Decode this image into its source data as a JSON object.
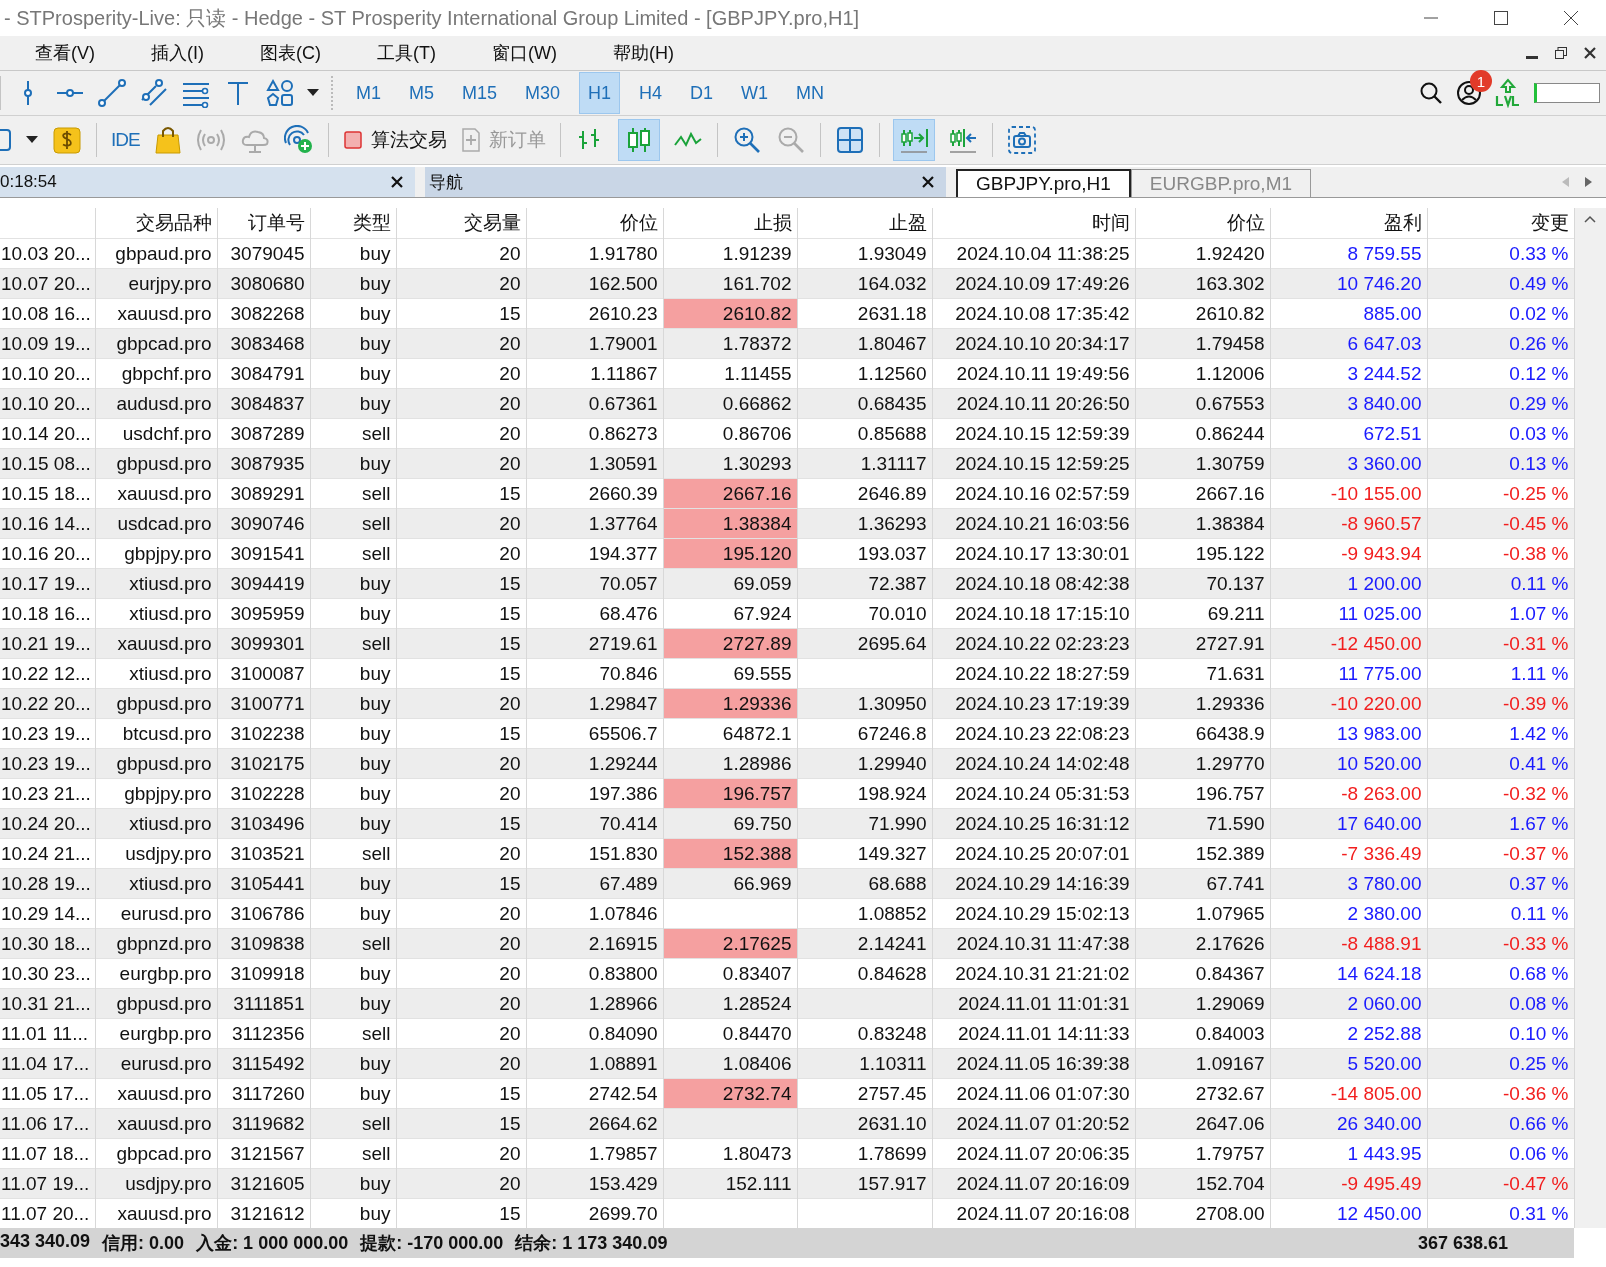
{
  "window": {
    "title": "- STProsperity-Live: 只读 - Hedge - ST Prosperity International Group Limited - [GBPJPY.pro,H1]"
  },
  "menu": [
    "查看(V)",
    "插入(I)",
    "图表(C)",
    "工具(T)",
    "窗口(W)",
    "帮助(H)"
  ],
  "timeframes": [
    {
      "label": "M1",
      "selected": false
    },
    {
      "label": "M5",
      "selected": false
    },
    {
      "label": "M15",
      "selected": false
    },
    {
      "label": "M30",
      "selected": false
    },
    {
      "label": "H1",
      "selected": true
    },
    {
      "label": "H4",
      "selected": false
    },
    {
      "label": "D1",
      "selected": false
    },
    {
      "label": "W1",
      "selected": false
    },
    {
      "label": "MN",
      "selected": false
    }
  ],
  "notifications": {
    "badge": "1"
  },
  "toolbar_2": {
    "ide": "IDE",
    "algo_trading": {
      "label": "算法交易",
      "on": false
    },
    "new_order": {
      "label": "新订单",
      "disabled": true
    },
    "chart_types": [
      {
        "selected": false
      },
      {
        "selected": true
      },
      {
        "selected": false
      }
    ],
    "scroll_tools": [
      {
        "selected": true
      },
      {
        "selected": false
      }
    ]
  },
  "panels": [
    {
      "title": "0:18:54"
    },
    {
      "title": "导航"
    }
  ],
  "chart_tabs": [
    {
      "label": "GBPJPY.pro,H1",
      "selected": true
    },
    {
      "label": "EURGBP.pro,M1",
      "selected": false
    }
  ],
  "table": {
    "columns": [
      "",
      "交易品种",
      "订单号",
      "类型",
      "交易量",
      "价位",
      "止损",
      "止盈",
      "时间",
      "价位",
      "盈利",
      "变更"
    ],
    "rows": [
      {
        "open": "10.03 20...",
        "symbol": "gbpaud.pro",
        "order": "3079045",
        "type": "buy",
        "volume": "20",
        "price": "1.91780",
        "sl": "1.91239",
        "tp": "1.93049",
        "time": "2024.10.04 11:38:25",
        "close": "1.92420",
        "profit": "8 759.55",
        "change": "0.33 %",
        "sl_hit": false,
        "loss": false
      },
      {
        "open": "10.07 20...",
        "symbol": "eurjpy.pro",
        "order": "3080680",
        "type": "buy",
        "volume": "20",
        "price": "162.500",
        "sl": "161.702",
        "tp": "164.032",
        "time": "2024.10.09 17:49:26",
        "close": "163.302",
        "profit": "10 746.20",
        "change": "0.49 %",
        "sl_hit": false,
        "loss": false
      },
      {
        "open": "10.08 16...",
        "symbol": "xauusd.pro",
        "order": "3082268",
        "type": "buy",
        "volume": "15",
        "price": "2610.23",
        "sl": "2610.82",
        "tp": "2631.18",
        "time": "2024.10.08 17:35:42",
        "close": "2610.82",
        "profit": "885.00",
        "change": "0.02 %",
        "sl_hit": true,
        "loss": false
      },
      {
        "open": "10.09 19...",
        "symbol": "gbpcad.pro",
        "order": "3083468",
        "type": "buy",
        "volume": "20",
        "price": "1.79001",
        "sl": "1.78372",
        "tp": "1.80467",
        "time": "2024.10.10 20:34:17",
        "close": "1.79458",
        "profit": "6 647.03",
        "change": "0.26 %",
        "sl_hit": false,
        "loss": false
      },
      {
        "open": "10.10 20...",
        "symbol": "gbpchf.pro",
        "order": "3084791",
        "type": "buy",
        "volume": "20",
        "price": "1.11867",
        "sl": "1.11455",
        "tp": "1.12560",
        "time": "2024.10.11 19:49:56",
        "close": "1.12006",
        "profit": "3 244.52",
        "change": "0.12 %",
        "sl_hit": false,
        "loss": false
      },
      {
        "open": "10.10 20...",
        "symbol": "audusd.pro",
        "order": "3084837",
        "type": "buy",
        "volume": "20",
        "price": "0.67361",
        "sl": "0.66862",
        "tp": "0.68435",
        "time": "2024.10.11 20:26:50",
        "close": "0.67553",
        "profit": "3 840.00",
        "change": "0.29 %",
        "sl_hit": false,
        "loss": false
      },
      {
        "open": "10.14 20...",
        "symbol": "usdchf.pro",
        "order": "3087289",
        "type": "sell",
        "volume": "20",
        "price": "0.86273",
        "sl": "0.86706",
        "tp": "0.85688",
        "time": "2024.10.15 12:59:39",
        "close": "0.86244",
        "profit": "672.51",
        "change": "0.03 %",
        "sl_hit": false,
        "loss": false
      },
      {
        "open": "10.15 08...",
        "symbol": "gbpusd.pro",
        "order": "3087935",
        "type": "buy",
        "volume": "20",
        "price": "1.30591",
        "sl": "1.30293",
        "tp": "1.31117",
        "time": "2024.10.15 12:59:25",
        "close": "1.30759",
        "profit": "3 360.00",
        "change": "0.13 %",
        "sl_hit": false,
        "loss": false
      },
      {
        "open": "10.15 18...",
        "symbol": "xauusd.pro",
        "order": "3089291",
        "type": "sell",
        "volume": "15",
        "price": "2660.39",
        "sl": "2667.16",
        "tp": "2646.89",
        "time": "2024.10.16 02:57:59",
        "close": "2667.16",
        "profit": "-10 155.00",
        "change": "-0.25 %",
        "sl_hit": true,
        "loss": true
      },
      {
        "open": "10.16 14...",
        "symbol": "usdcad.pro",
        "order": "3090746",
        "type": "sell",
        "volume": "20",
        "price": "1.37764",
        "sl": "1.38384",
        "tp": "1.36293",
        "time": "2024.10.21 16:03:56",
        "close": "1.38384",
        "profit": "-8 960.57",
        "change": "-0.45 %",
        "sl_hit": true,
        "loss": true
      },
      {
        "open": "10.16 20...",
        "symbol": "gbpjpy.pro",
        "order": "3091541",
        "type": "sell",
        "volume": "20",
        "price": "194.377",
        "sl": "195.120",
        "tp": "193.037",
        "time": "2024.10.17 13:30:01",
        "close": "195.122",
        "profit": "-9 943.94",
        "change": "-0.38 %",
        "sl_hit": true,
        "loss": true
      },
      {
        "open": "10.17 19...",
        "symbol": "xtiusd.pro",
        "order": "3094419",
        "type": "buy",
        "volume": "15",
        "price": "70.057",
        "sl": "69.059",
        "tp": "72.387",
        "time": "2024.10.18 08:42:38",
        "close": "70.137",
        "profit": "1 200.00",
        "change": "0.11 %",
        "sl_hit": false,
        "loss": false
      },
      {
        "open": "10.18 16...",
        "symbol": "xtiusd.pro",
        "order": "3095959",
        "type": "buy",
        "volume": "15",
        "price": "68.476",
        "sl": "67.924",
        "tp": "70.010",
        "time": "2024.10.18 17:15:10",
        "close": "69.211",
        "profit": "11 025.00",
        "change": "1.07 %",
        "sl_hit": false,
        "loss": false
      },
      {
        "open": "10.21 19...",
        "symbol": "xauusd.pro",
        "order": "3099301",
        "type": "sell",
        "volume": "15",
        "price": "2719.61",
        "sl": "2727.89",
        "tp": "2695.64",
        "time": "2024.10.22 02:23:23",
        "close": "2727.91",
        "profit": "-12 450.00",
        "change": "-0.31 %",
        "sl_hit": true,
        "loss": true
      },
      {
        "open": "10.22 12...",
        "symbol": "xtiusd.pro",
        "order": "3100087",
        "type": "buy",
        "volume": "15",
        "price": "70.846",
        "sl": "69.555",
        "time": "2024.10.22 18:27:59",
        "close": "71.631",
        "profit": "11 775.00",
        "change": "1.11 %",
        "sl_hit": false,
        "loss": false
      },
      {
        "open": "10.22 20...",
        "symbol": "gbpusd.pro",
        "order": "3100771",
        "type": "buy",
        "volume": "20",
        "price": "1.29847",
        "sl": "1.29336",
        "tp": "1.30950",
        "time": "2024.10.23 17:19:39",
        "close": "1.29336",
        "profit": "-10 220.00",
        "change": "-0.39 %",
        "sl_hit": true,
        "loss": true
      },
      {
        "open": "10.23 19...",
        "symbol": "btcusd.pro",
        "order": "3102238",
        "type": "buy",
        "volume": "15",
        "price": "65506.7",
        "sl": "64872.1",
        "tp": "67246.8",
        "time": "2024.10.23 22:08:23",
        "close": "66438.9",
        "profit": "13 983.00",
        "change": "1.42 %",
        "sl_hit": false,
        "loss": false
      },
      {
        "open": "10.23 19...",
        "symbol": "gbpusd.pro",
        "order": "3102175",
        "type": "buy",
        "volume": "20",
        "price": "1.29244",
        "sl": "1.28986",
        "tp": "1.29940",
        "time": "2024.10.24 14:02:48",
        "close": "1.29770",
        "profit": "10 520.00",
        "change": "0.41 %",
        "sl_hit": false,
        "loss": false
      },
      {
        "open": "10.23 21...",
        "symbol": "gbpjpy.pro",
        "order": "3102228",
        "type": "buy",
        "volume": "20",
        "price": "197.386",
        "sl": "196.757",
        "tp": "198.924",
        "time": "2024.10.24 05:31:53",
        "close": "196.757",
        "profit": "-8 263.00",
        "change": "-0.32 %",
        "sl_hit": true,
        "loss": true
      },
      {
        "open": "10.24 20...",
        "symbol": "xtiusd.pro",
        "order": "3103496",
        "type": "buy",
        "volume": "15",
        "price": "70.414",
        "sl": "69.750",
        "tp": "71.990",
        "time": "2024.10.25 16:31:12",
        "close": "71.590",
        "profit": "17 640.00",
        "change": "1.67 %",
        "sl_hit": false,
        "loss": false
      },
      {
        "open": "10.24 21...",
        "symbol": "usdjpy.pro",
        "order": "3103521",
        "type": "sell",
        "volume": "20",
        "price": "151.830",
        "sl": "152.388",
        "tp": "149.327",
        "time": "2024.10.25 20:07:01",
        "close": "152.389",
        "profit": "-7 336.49",
        "change": "-0.37 %",
        "sl_hit": true,
        "loss": true
      },
      {
        "open": "10.28 19...",
        "symbol": "xtiusd.pro",
        "order": "3105441",
        "type": "buy",
        "volume": "15",
        "price": "67.489",
        "sl": "66.969",
        "tp": "68.688",
        "time": "2024.10.29 14:16:39",
        "close": "67.741",
        "profit": "3 780.00",
        "change": "0.37 %",
        "sl_hit": false,
        "loss": false
      },
      {
        "open": "10.29 14...",
        "symbol": "eurusd.pro",
        "order": "3106786",
        "type": "buy",
        "volume": "20",
        "price": "1.07846",
        "tp": "1.08852",
        "time": "2024.10.29 15:02:13",
        "close": "1.07965",
        "profit": "2 380.00",
        "change": "0.11 %",
        "sl_hit": false,
        "loss": false
      },
      {
        "open": "10.30 18...",
        "symbol": "gbpnzd.pro",
        "order": "3109838",
        "type": "sell",
        "volume": "20",
        "price": "2.16915",
        "sl": "2.17625",
        "tp": "2.14241",
        "time": "2024.10.31 11:47:38",
        "close": "2.17626",
        "profit": "-8 488.91",
        "change": "-0.33 %",
        "sl_hit": true,
        "loss": true
      },
      {
        "open": "10.30 23...",
        "symbol": "eurgbp.pro",
        "order": "3109918",
        "type": "buy",
        "volume": "20",
        "price": "0.83800",
        "sl": "0.83407",
        "tp": "0.84628",
        "time": "2024.10.31 21:21:02",
        "close": "0.84367",
        "profit": "14 624.18",
        "change": "0.68 %",
        "sl_hit": false,
        "loss": false
      },
      {
        "open": "10.31 21...",
        "symbol": "gbpusd.pro",
        "order": "3111851",
        "type": "buy",
        "volume": "20",
        "price": "1.28966",
        "sl": "1.28524",
        "time": "2024.11.01 11:01:31",
        "close": "1.29069",
        "profit": "2 060.00",
        "change": "0.08 %",
        "sl_hit": false,
        "loss": false
      },
      {
        "open": "11.01 11...",
        "symbol": "eurgbp.pro",
        "order": "3112356",
        "type": "sell",
        "volume": "20",
        "price": "0.84090",
        "sl": "0.84470",
        "tp": "0.83248",
        "time": "2024.11.01 14:11:33",
        "close": "0.84003",
        "profit": "2 252.88",
        "change": "0.10 %",
        "sl_hit": false,
        "loss": false
      },
      {
        "open": "11.04 17...",
        "symbol": "eurusd.pro",
        "order": "3115492",
        "type": "buy",
        "volume": "20",
        "price": "1.08891",
        "sl": "1.08406",
        "tp": "1.10311",
        "time": "2024.11.05 16:39:38",
        "close": "1.09167",
        "profit": "5 520.00",
        "change": "0.25 %",
        "sl_hit": false,
        "loss": false
      },
      {
        "open": "11.05 17...",
        "symbol": "xauusd.pro",
        "order": "3117260",
        "type": "buy",
        "volume": "15",
        "price": "2742.54",
        "sl": "2732.74",
        "tp": "2757.45",
        "time": "2024.11.06 01:07:30",
        "close": "2732.67",
        "profit": "-14 805.00",
        "change": "-0.36 %",
        "sl_hit": true,
        "loss": true
      },
      {
        "open": "11.06 17...",
        "symbol": "xauusd.pro",
        "order": "3119682",
        "type": "sell",
        "volume": "15",
        "price": "2664.62",
        "tp": "2631.10",
        "time": "2024.11.07 01:20:52",
        "close": "2647.06",
        "profit": "26 340.00",
        "change": "0.66 %",
        "sl_hit": false,
        "loss": false
      },
      {
        "open": "11.07 18...",
        "symbol": "gbpcad.pro",
        "order": "3121567",
        "type": "sell",
        "volume": "20",
        "price": "1.79857",
        "sl": "1.80473",
        "tp": "1.78699",
        "time": "2024.11.07 20:06:35",
        "close": "1.79757",
        "profit": "1 443.95",
        "change": "0.06 %",
        "sl_hit": false,
        "loss": false
      },
      {
        "open": "11.07 19...",
        "symbol": "usdjpy.pro",
        "order": "3121605",
        "type": "buy",
        "volume": "20",
        "price": "153.429",
        "sl": "152.111",
        "tp": "157.917",
        "time": "2024.11.07 20:16:09",
        "close": "152.704",
        "profit": "-9 495.49",
        "change": "-0.47 %",
        "sl_hit": false,
        "loss": true
      },
      {
        "open": "11.07 20...",
        "symbol": "xauusd.pro",
        "order": "3121612",
        "type": "buy",
        "volume": "15",
        "price": "2699.70",
        "time": "2024.11.07 20:16:08",
        "close": "2708.00",
        "profit": "12 450.00",
        "change": "0.31 %",
        "sl_hit": false,
        "loss": false
      }
    ]
  },
  "summary": {
    "balance": "343 340.09",
    "credit": "信用: 0.00",
    "deposit": "入金: 1 000 000.00",
    "withdrawal": "提款: -170 000.00",
    "result": "结余: 1 173 340.09",
    "total_profit": "367 638.61"
  }
}
